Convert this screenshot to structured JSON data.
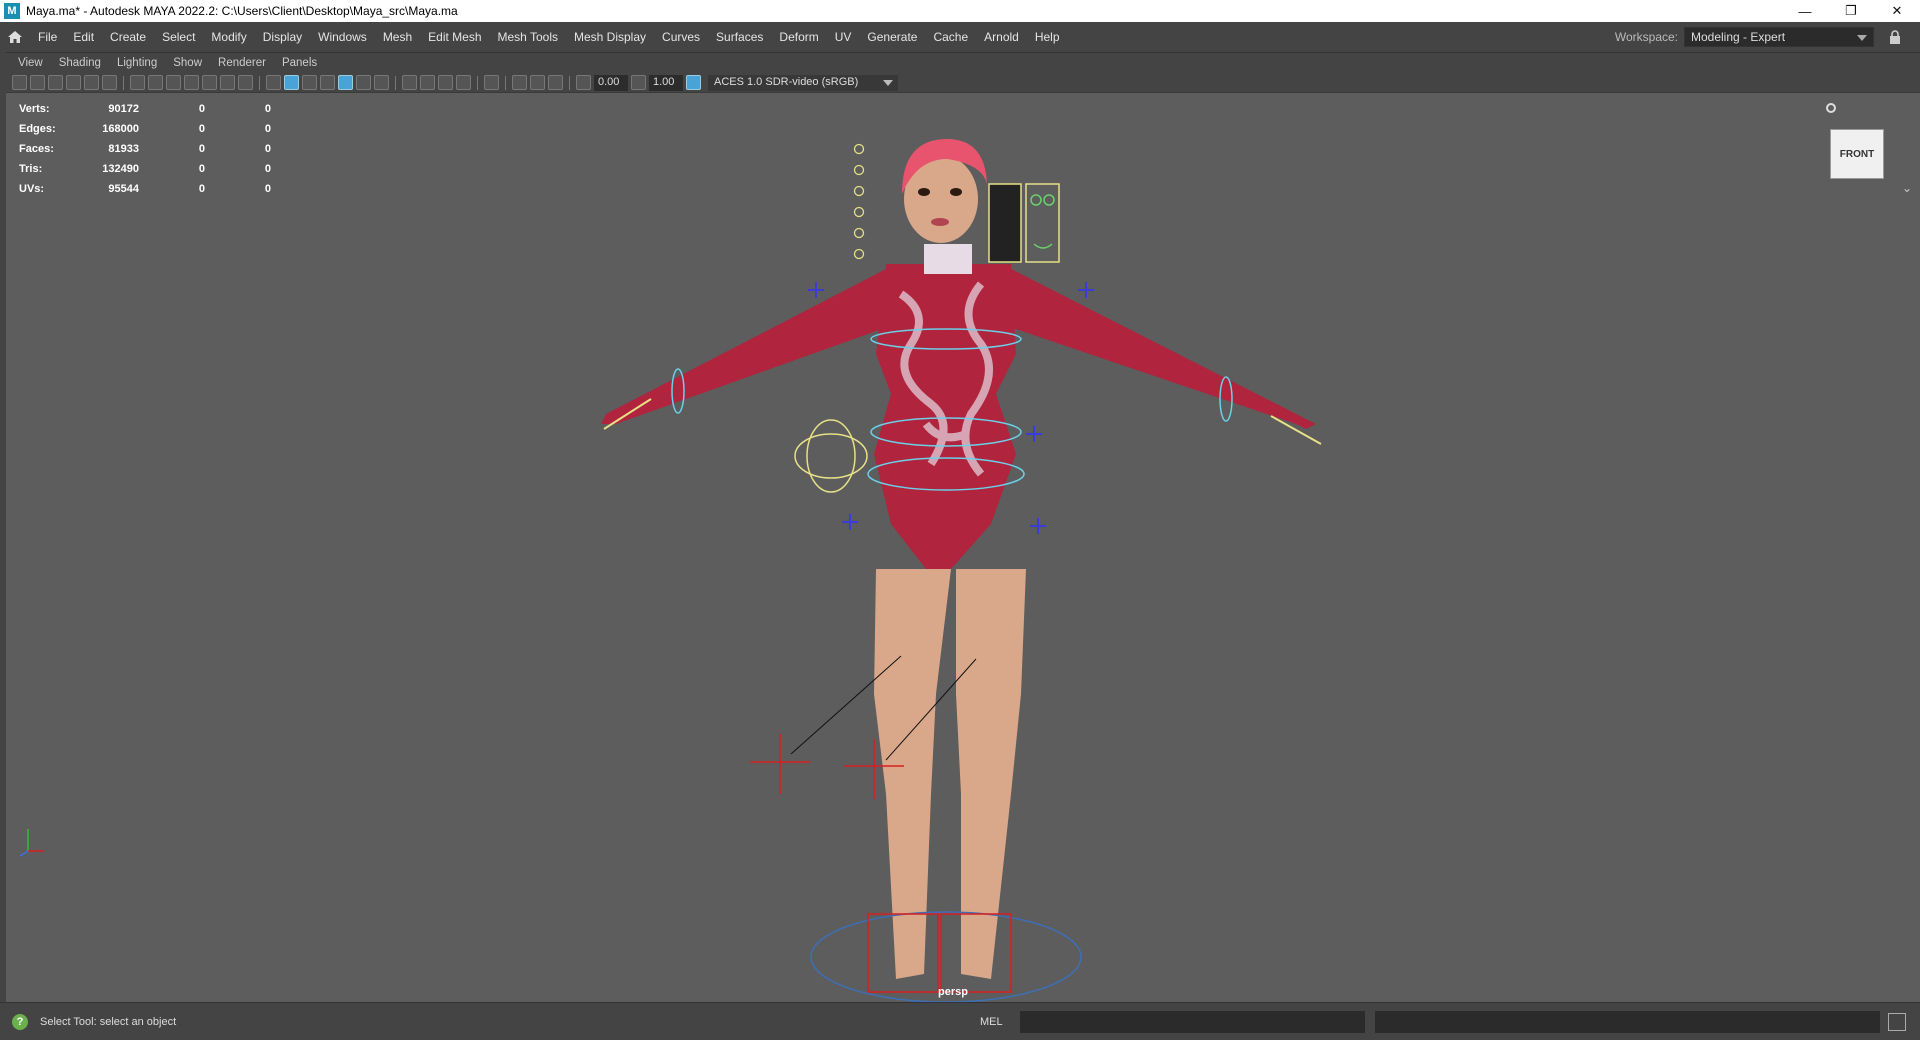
{
  "window": {
    "title": "Maya.ma* - Autodesk MAYA 2022.2: C:\\Users\\Client\\Desktop\\Maya_src\\Maya.ma",
    "app_icon": "M",
    "minimize": "—",
    "restore": "❐",
    "close": "✕"
  },
  "menu": [
    "File",
    "Edit",
    "Create",
    "Select",
    "Modify",
    "Display",
    "Windows",
    "Mesh",
    "Edit Mesh",
    "Mesh Tools",
    "Mesh Display",
    "Curves",
    "Surfaces",
    "Deform",
    "UV",
    "Generate",
    "Cache",
    "Arnold",
    "Help"
  ],
  "workspace": {
    "label": "Workspace:",
    "value": "Modeling - Expert"
  },
  "panel_menu": [
    "View",
    "Shading",
    "Lighting",
    "Show",
    "Renderer",
    "Panels"
  ],
  "toolbar": {
    "near": "0.00",
    "exposure": "1.00",
    "colorspace": "ACES 1.0 SDR-video (sRGB)"
  },
  "hud": [
    {
      "label": "Verts:",
      "value": "90172",
      "sel": "0",
      "comp": "0"
    },
    {
      "label": "Edges:",
      "value": "168000",
      "sel": "0",
      "comp": "0"
    },
    {
      "label": "Faces:",
      "value": "81933",
      "sel": "0",
      "comp": "0"
    },
    {
      "label": "Tris:",
      "value": "132490",
      "sel": "0",
      "comp": "0"
    },
    {
      "label": "UVs:",
      "value": "95544",
      "sel": "0",
      "comp": "0"
    }
  ],
  "viewport": {
    "camera": "persp",
    "viewcube": "FRONT"
  },
  "status": {
    "help_icon": "?",
    "message": "Select Tool: select an object",
    "mel": "MEL"
  },
  "colors": {
    "skin": "#d9a88a",
    "hair": "#e8546d",
    "suit_red": "#b0243e",
    "suit_light": "#e7dbe5",
    "rig_cyan": "#6bd0e8",
    "rig_yellow": "#e7e086",
    "rig_blue": "#3b3bd8",
    "rig_red": "#d82020"
  }
}
